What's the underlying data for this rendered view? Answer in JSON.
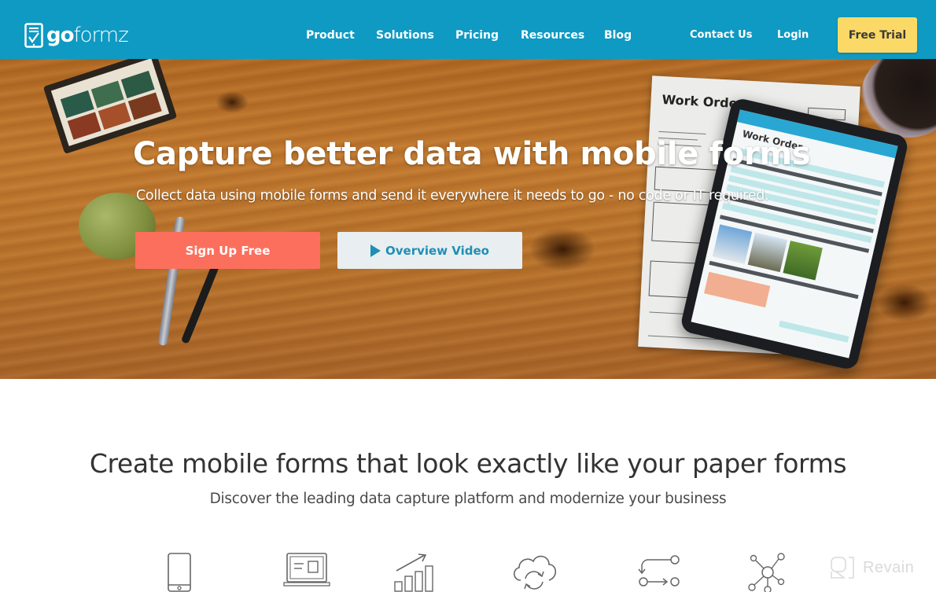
{
  "header": {
    "logo": {
      "bold": "go",
      "light": "formz"
    },
    "nav": [
      {
        "label": "Product"
      },
      {
        "label": "Solutions"
      },
      {
        "label": "Pricing"
      },
      {
        "label": "Resources"
      },
      {
        "label": "Blog"
      }
    ],
    "secondary_nav": [
      {
        "label": "Contact Us"
      },
      {
        "label": "Login"
      }
    ],
    "cta_label": "Free Trial",
    "colors": {
      "bar": "#0f9ac3",
      "cta": "#fad967"
    }
  },
  "hero": {
    "title": "Capture better data with mobile forms",
    "subtitle": "Collect data using mobile forms and send it everywhere it needs to go - no code or IT required.",
    "primary_button": "Sign Up Free",
    "secondary_button": "Overview Video",
    "paper_title": "Work Order",
    "tablet_title": "Work Order",
    "colors": {
      "primary_button": "#fb6f5c",
      "secondary_button_text": "#1f8fb3"
    }
  },
  "features": {
    "title": "Create mobile forms that look exactly like your paper forms",
    "subtitle": "Discover the leading data capture platform and modernize your business",
    "icons": [
      "mobile-phone-icon",
      "laptop-form-icon",
      "growth-chart-icon",
      "cloud-sync-icon",
      "workflow-icon",
      "network-icon"
    ]
  },
  "watermark": {
    "text": "Revain"
  }
}
